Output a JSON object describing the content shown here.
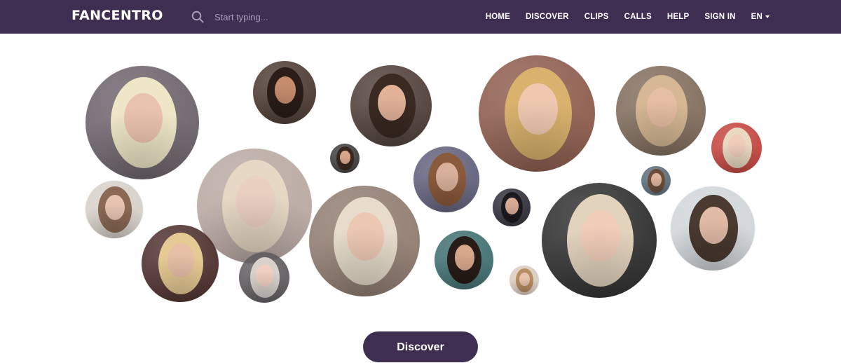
{
  "header": {
    "logo": "FANCENTRO",
    "search": {
      "placeholder": "Start typing..."
    },
    "nav": [
      "HOME",
      "DISCOVER",
      "CLIPS",
      "CALLS",
      "HELP",
      "SIGN IN"
    ],
    "language": "EN"
  },
  "colors": {
    "brand": "#3d2e52",
    "text_on_brand": "#ffffff",
    "placeholder": "#a89bb8",
    "background": "#ffffff"
  },
  "icons": {
    "search": "search-icon",
    "language_caret": "chevron-down-icon"
  },
  "cta": {
    "label": "Discover"
  },
  "creator_bubbles": [
    {
      "bg": "#6a6168",
      "hair": "#efe6c7",
      "skin": "#e9c2ae"
    },
    {
      "bg": "#4a3830",
      "hair": "#2b1d18",
      "skin": "#c58c6d"
    },
    {
      "bg": "#4d3c36",
      "hair": "#3a2a22",
      "skin": "#e2b198"
    },
    {
      "bg": "#8b5a4a",
      "hair": "#d9b26d",
      "skin": "#f0c8b0"
    },
    {
      "bg": "#7f6b5a",
      "hair": "#d6b994",
      "skin": "#e6bea3"
    },
    {
      "bg": "#c2413b",
      "hair": "#e8d9c0",
      "skin": "#f0cdbb"
    },
    {
      "bg": "#d6cfc8",
      "hair": "#8a6a55",
      "skin": "#e7c4b2"
    },
    {
      "bg": "#b8a7a0",
      "hair": "#e6d8c4",
      "skin": "#ead0c1"
    },
    {
      "bg": "#3d3a3a",
      "hair": "#3a2820",
      "skin": "#d9a98e"
    },
    {
      "bg": "#5f5e7a",
      "hair": "#8a5a3c",
      "skin": "#d9b09a"
    },
    {
      "bg": "#5a6a78",
      "hair": "#6a4e3a",
      "skin": "#ddb39c"
    },
    {
      "bg": "#2e2c36",
      "hair": "#1d1a1f",
      "skin": "#d9ab95"
    },
    {
      "bg": "#2b2b2b",
      "hair": "#e2d3bd",
      "skin": "#f0cdb9"
    },
    {
      "bg": "#cfd5d8",
      "hair": "#4a3a30",
      "skin": "#e1bba6"
    },
    {
      "bg": "#4b2d2a",
      "hair": "#e6ca93",
      "skin": "#e6bfa6"
    },
    {
      "bg": "#5e5a5e",
      "hair": "#d7d0cb",
      "skin": "#eecfc0"
    },
    {
      "bg": "#8e7a6e",
      "hair": "#e7dccb",
      "skin": "#ecc8b3"
    },
    {
      "bg": "#3d6d6e",
      "hair": "#271c18",
      "skin": "#d7a88b"
    },
    {
      "bg": "#d8cbbf",
      "hair": "#b88d61",
      "skin": "#e8c4ad"
    },
    {
      "bg": "#1c1b1d",
      "hair": "#e8dcc8",
      "skin": "#efcdb8"
    },
    {
      "bg": "#d7cfca",
      "hair": "#3c2b24",
      "skin": "#e2b99f"
    },
    {
      "bg": "#caa596",
      "hair": "#e3c79b",
      "skin": "#eecbb6"
    }
  ]
}
